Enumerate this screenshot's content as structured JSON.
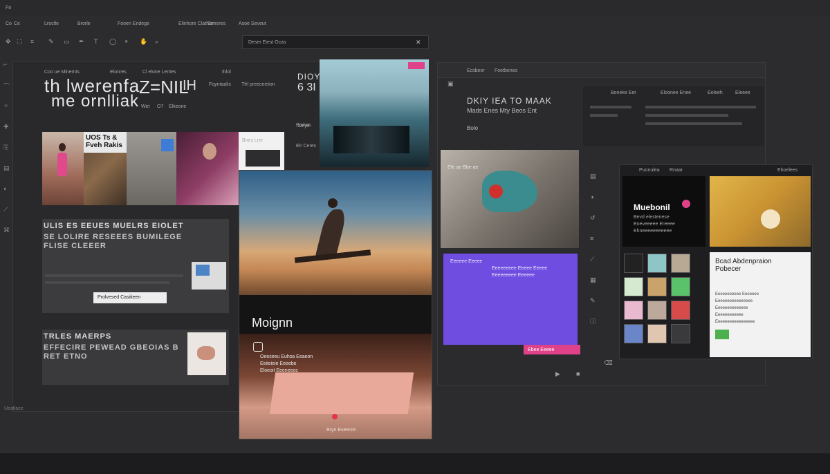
{
  "app": {
    "menu_corner": "Fo",
    "menu": [
      "Co",
      "Ce",
      "Lroctle",
      "Brorle",
      "Fooen Endege",
      "Elinhore Clathon",
      "Seneres",
      "Asoe Seveut"
    ],
    "search_placeholder": "Deser Eiest Ocas",
    "footer": "Ueatlaze",
    "colors": {
      "bg": "#2c2c2e",
      "accent_pink": "#e0428a",
      "accent_purple": "#6e4de0"
    }
  },
  "left_window": {
    "header_items": [
      "Coo ue Mlnemts",
      "Elonres",
      "Cl elone Lentes",
      "Ilrlol"
    ],
    "headline_line1": "th lwerenfa",
    "headline_line2": "me ornlliak",
    "headline_glyph1": "Z=NIL",
    "headline_glyph2": "IH",
    "side_labels": [
      "Fqyntaalis",
      "Tfrl preeceetion"
    ],
    "bottom_labels": [
      "Wet",
      "O7",
      "Elkeone"
    ],
    "thumb_title": "UOS Ts & Fveh Rakis",
    "section1_title": "ULIS ES EEUES MUELRS EIOLET",
    "section1_text": "SE LOLIRE RESEEES BUMILEGE FLISE CLEEER",
    "section1_caption": "Prolvesed Casiiteen",
    "section2_title": "TRLES MAERPS",
    "section2_text": "EFFECIRE PEWEAD GBEOIAS BRET ETNO",
    "side_caption": "Deye"
  },
  "top_card": {
    "top_line": "DIOY",
    "big": "6 3I",
    "label1": "Borluts",
    "label2": "Elr Ceres",
    "label3": "Bnes Lrer"
  },
  "center_card": {
    "title": "Moignn",
    "lines": [
      "Oeeseeu Euhsa Eeaeon",
      "Eeiieieie Eeeebe",
      "Eloeoit Eeeneeoc"
    ],
    "footer": "Bryn Eseenre"
  },
  "right_window": {
    "tab1": "Ecsbeer",
    "tab2": "Foetbenes",
    "title": "DKIY IEA TO MAAK",
    "subtitle": "Mads Enes Mty Beos Ent",
    "tag": "Bolo",
    "panel_labels": [
      "Boneke Eet",
      "Eloonee Enee",
      "Eoleeh",
      "Eleeee"
    ],
    "image_caption": "Efe ae Bbe ae",
    "purple_lines": [
      "Eeeeee Eeeee",
      "Eeeeeeeee Eeeee Eeeee",
      "Eeeeeeeee Eeeeee"
    ],
    "pink_button": "Ebee Eeeee"
  },
  "right_panel": {
    "tabs": [
      "Puonulea",
      "Rnaar",
      "Ehoelees"
    ],
    "title": "Muebonil",
    "desc": [
      "Bevd elestenese",
      "Eneveeeee Ereeee",
      "Ehneeeeeeeeeee"
    ],
    "card_title": "Bcad Abdenpraion Pobecer",
    "card_lines": [
      "Eeeeeeeeeee Eeeeeee",
      "Eeeeeeeeeeeeeeee",
      "Eeeeeeeeeeeeee",
      "Eeeeeeeeeeee",
      "Eeeeeeeeeeeeeeeee"
    ]
  }
}
